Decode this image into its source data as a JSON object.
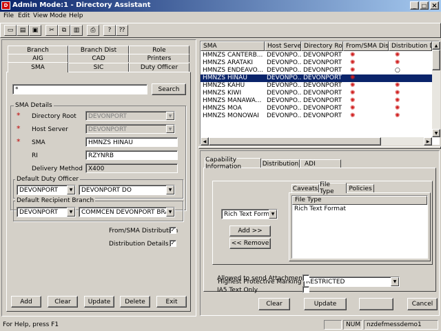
{
  "title_bar": {
    "title": "Admin Mode:1 - Directory Assistant",
    "min": "_",
    "max": "□",
    "close": "×"
  },
  "menu": [
    "File",
    "Edit",
    "View",
    "Mode",
    "Help"
  ],
  "tabs_left": {
    "row1": [
      "Branch",
      "Branch Dist",
      "Role"
    ],
    "row2": [
      "AIG",
      "CAD",
      "Printers"
    ],
    "row3": [
      "SMA",
      "SIC",
      "Duty Officer"
    ]
  },
  "search": {
    "value": "*",
    "button": "Search"
  },
  "sma_details": {
    "legend": "SMA Details",
    "directory_root_label": "Directory Root",
    "directory_root_value": "DEVONPORT",
    "host_server_label": "Host Server",
    "host_server_value": "DEVONPORT",
    "sma_label": "SMA",
    "sma_value": "HMNZS HINAU",
    "ri_label": "RI",
    "ri_value": "RZYNRB",
    "delivery_label": "Delivery Method",
    "delivery_value": "X400",
    "asterisk": "*"
  },
  "duty_officer": {
    "legend": "Default Duty Officer",
    "a": "DEVONPORT",
    "b": "DEVONPORT DO"
  },
  "recipient_branch": {
    "legend": "Default Recipient Branch",
    "a": "DEVONPORT",
    "b": "COMMCEN DEVONPORT BRAN"
  },
  "checks": {
    "from_sma": "From/SMA Distribution",
    "dist_details": "Distribution Details",
    "checked": "✓"
  },
  "left_buttons": [
    "Add",
    "Clear",
    "Update",
    "Delete",
    "Exit"
  ],
  "list": {
    "headers": [
      "SMA",
      "Host Server",
      "Directory Root",
      "From/SMA Dis...",
      "Distribution Deta"
    ],
    "rows": [
      {
        "sma": "HMNZS CANTERB...",
        "host": "DEVONPO...",
        "root": "DEVONPORT"
      },
      {
        "sma": "HMNZS ARATAKI",
        "host": "DEVONPO...",
        "root": "DEVONPORT"
      },
      {
        "sma": "HMNZS ENDEAVO...",
        "host": "DEVONPO...",
        "root": "DEVONPORT"
      },
      {
        "sma": "HMNZS HINAU",
        "host": "DEVONPO...",
        "root": "DEVONPORT"
      },
      {
        "sma": "HMNZS KAHU",
        "host": "DEVONPO...",
        "root": "DEVONPORT"
      },
      {
        "sma": "HMNZS KIWI",
        "host": "DEVONPO...",
        "root": "DEVONPORT"
      },
      {
        "sma": "HMNZS MANAWA...",
        "host": "DEVONPO...",
        "root": "DEVONPORT"
      },
      {
        "sma": "HMNZS MOA",
        "host": "DEVONPO...",
        "root": "DEVONPORT"
      },
      {
        "sma": "HMNZS MONOWAI",
        "host": "DEVONPO...",
        "root": "DEVONPORT"
      }
    ]
  },
  "right_tabs": [
    "Capability Information",
    "Distribution",
    "ADI"
  ],
  "inner_tabs": [
    "Caveats",
    "File Type",
    "Policies"
  ],
  "file_type": {
    "select": "Rich Text Format",
    "add": "Add >>",
    "remove": "<< Remove",
    "col": "File Type",
    "items": [
      "Rich Text Format"
    ]
  },
  "marking": {
    "label": "Highest Protective Marking",
    "value": "RESTRICTED"
  },
  "attachments_label": "Allowed to send Attachments",
  "ia5_label": "IA5 Text Only",
  "right_buttons": [
    "Clear",
    "Update",
    "",
    "Cancel"
  ],
  "status": {
    "help": "For Help, press F1",
    "num": "NUM",
    "user": "nzdefmessdemo1"
  }
}
